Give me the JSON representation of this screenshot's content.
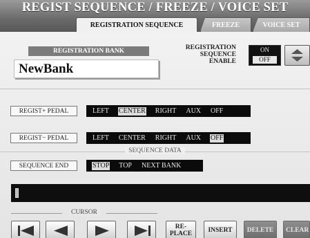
{
  "header": {
    "title": "REGIST SEQUENCE / FREEZE / VOICE SET",
    "tabs": [
      "REGISTRATION SEQUENCE",
      "FREEZE",
      "VOICE SET"
    ]
  },
  "bank": {
    "label": "REGISTRATION BANK",
    "name": "NewBank"
  },
  "enable": {
    "label_lines": [
      "REGISTRATION",
      "SEQUENCE",
      "ENABLE"
    ],
    "options": [
      "ON",
      "OFF"
    ],
    "selected": "OFF"
  },
  "pedal_plus": {
    "label": "REGIST+ PEDAL",
    "options": [
      "LEFT",
      "CENTER",
      "RIGHT",
      "AUX",
      "OFF"
    ],
    "selected": "CENTER"
  },
  "pedal_minus": {
    "label": "REGIST− PEDAL",
    "options": [
      "LEFT",
      "CENTER",
      "RIGHT",
      "AUX",
      "OFF"
    ],
    "selected": "OFF"
  },
  "sequence": {
    "title": "SEQUENCE DATA",
    "end_label": "SEQUENCE END",
    "end_options": [
      "STOP",
      "TOP",
      "NEXT BANK"
    ],
    "end_selected": "STOP"
  },
  "cursor": {
    "title": "CURSOR",
    "buttons": [
      "first-icon",
      "left-arrow-icon",
      "right-arrow-icon",
      "last-icon"
    ]
  },
  "actions": {
    "replace_lines": [
      "RE-",
      "PLACE"
    ],
    "insert": "INSERT",
    "delete": "DELETE",
    "clear": "CLEAR"
  }
}
